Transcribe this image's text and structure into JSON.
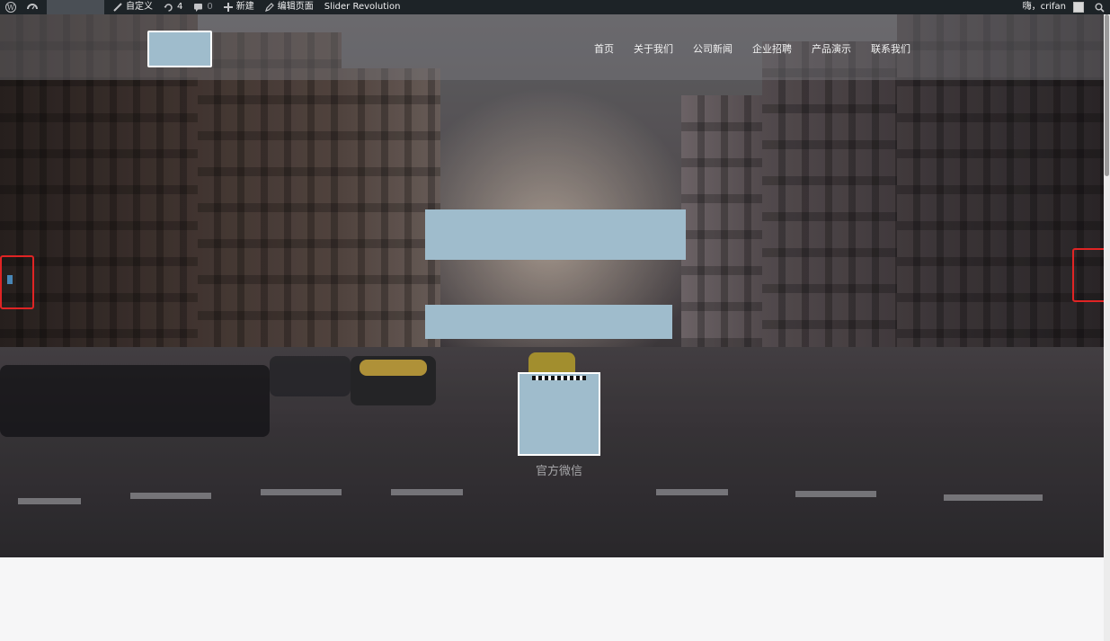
{
  "adminbar": {
    "customize_label": "自定义",
    "updates_count": "4",
    "comments_count": "0",
    "new_label": "新建",
    "edit_page_label": "编辑页面",
    "plugin_label": "Slider Revolution",
    "greeting": "嗨，crifan"
  },
  "nav": {
    "items": [
      "首页",
      "关于我们",
      "公司新闻",
      "企业招聘",
      "产品演示",
      "联系我们"
    ]
  },
  "hero": {
    "qr_caption": "官方微信"
  },
  "colors": {
    "adminbar_bg": "#1d2327",
    "placeholder_block": "#9fbccc",
    "arrow_highlight": "#e02424"
  }
}
